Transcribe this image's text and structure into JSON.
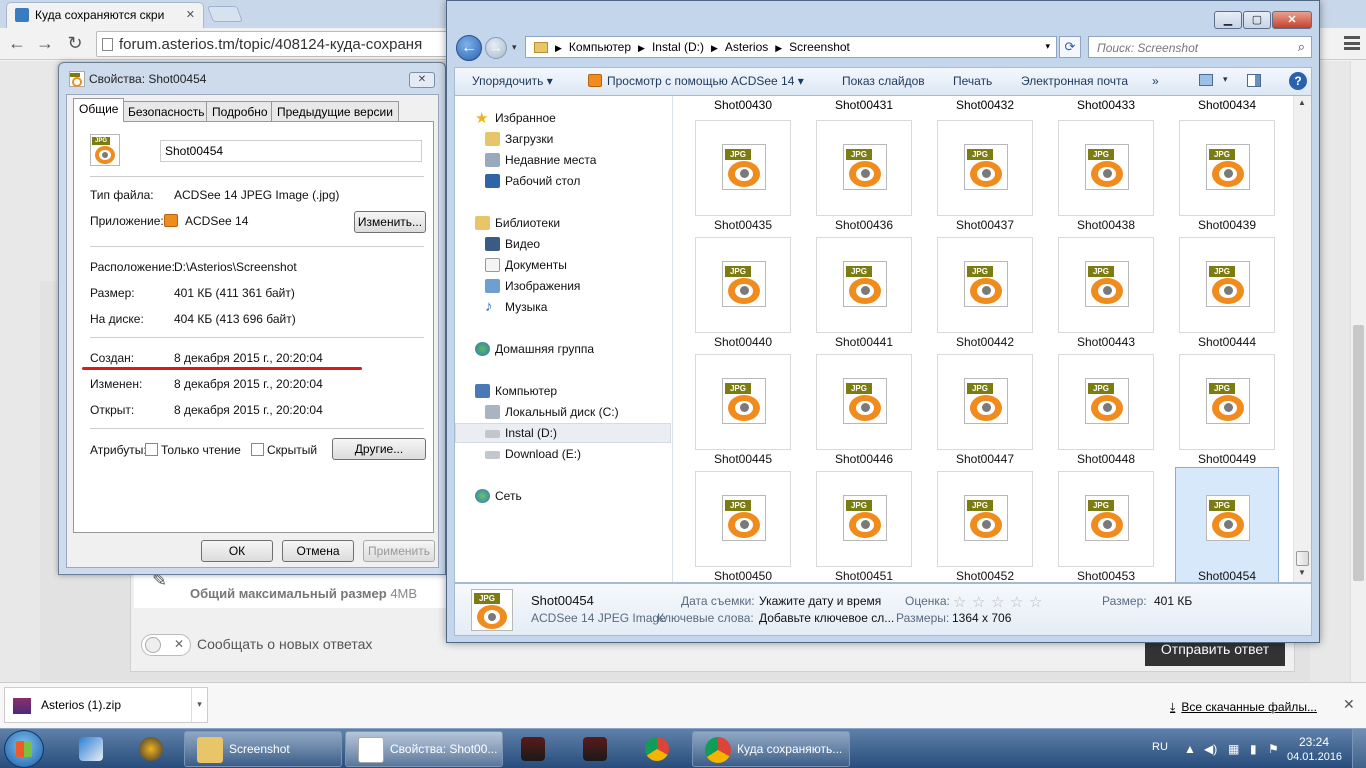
{
  "browser": {
    "tab_title": "Куда сохраняются скри",
    "url": "forum.asterios.tm/topic/408124-куда-сохраня",
    "forum": {
      "max_size_label": "Общий максимальный размер",
      "max_size_value": "4MB",
      "toggle_label": "Сообщать о новых ответах",
      "submit_label": "Отправить ответ"
    },
    "downloads": {
      "file_name": "Asterios (1).zip",
      "all_downloads_label": "Все скачанные файлы..."
    }
  },
  "properties": {
    "title": "Свойства: Shot00454",
    "tabs": [
      "Общие",
      "Безопасность",
      "Подробно",
      "Предыдущие версии"
    ],
    "file_name": "Shot00454",
    "file_type_label": "Тип файла:",
    "file_type": "ACDSee 14 JPEG Image (.jpg)",
    "app_label": "Приложение:",
    "app": "ACDSee 14",
    "change_btn": "Изменить...",
    "location_label": "Расположение:",
    "location": "D:\\Asterios\\Screenshot",
    "size_label": "Размер:",
    "size": "401 КБ (411 361 байт)",
    "disk_label": "На диске:",
    "disk": "404 КБ (413 696 байт)",
    "created_label": "Создан:",
    "created": "8 декабря 2015 г., 20:20:04",
    "modified_label": "Изменен:",
    "modified": "8 декабря 2015 г., 20:20:04",
    "opened_label": "Открыт:",
    "opened": "8 декабря 2015 г., 20:20:04",
    "attrs_label": "Атрибуты:",
    "readonly_label": "Только чтение",
    "hidden_label": "Скрытый",
    "others_btn": "Другие...",
    "ok_btn": "ОК",
    "cancel_btn": "Отмена",
    "apply_btn": "Применить",
    "jpg_tag": "JPG"
  },
  "explorer": {
    "path": [
      "Компьютер",
      "Instal (D:)",
      "Asterios",
      "Screenshot"
    ],
    "search_placeholder": "Поиск: Screenshot",
    "toolbar": {
      "organize": "Упорядочить",
      "view_with": "Просмотр с помощью ACDSee 14",
      "slideshow": "Показ слайдов",
      "print": "Печать",
      "email": "Электронная почта",
      "more": "»"
    },
    "nav": {
      "favorites": "Избранное",
      "downloads": "Загрузки",
      "recent": "Недавние места",
      "desktop": "Рабочий стол",
      "libraries": "Библиотеки",
      "video": "Видео",
      "documents": "Документы",
      "images": "Изображения",
      "music": "Музыка",
      "homegroup": "Домашняя группа",
      "computer": "Компьютер",
      "drive_c": "Локальный диск (C:)",
      "drive_d": "Instal (D:)",
      "drive_e": "Download (E:)",
      "network": "Сеть"
    },
    "top_row": [
      "Shot00430",
      "Shot00431",
      "Shot00432",
      "Shot00433",
      "Shot00434"
    ],
    "files": [
      "Shot00435",
      "Shot00436",
      "Shot00437",
      "Shot00438",
      "Shot00439",
      "Shot00440",
      "Shot00441",
      "Shot00442",
      "Shot00443",
      "Shot00444",
      "Shot00445",
      "Shot00446",
      "Shot00447",
      "Shot00448",
      "Shot00449",
      "Shot00450",
      "Shot00451",
      "Shot00452",
      "Shot00453",
      "Shot00454"
    ],
    "selected_file": "Shot00454",
    "details": {
      "name": "Shot00454",
      "type": "ACDSee 14 JPEG Image",
      "date_label": "Дата съемки:",
      "date_value": "Укажите дату и время",
      "rating_label": "Оценка:",
      "size_label": "Размер:",
      "size_value": "401 КБ",
      "keywords_label": "Ключевые слова:",
      "keywords_value": "Добавьте ключевое сл...",
      "dims_label": "Размеры:",
      "dims_value": "1364 x 706"
    }
  },
  "taskbar": {
    "tasks": [
      "Screenshot",
      "Свойства: Shot00...",
      "Куда сохраняють..."
    ],
    "lang": "RU",
    "time": "23:24",
    "date": "04.01.2016"
  },
  "colors": {
    "highlight_red": "#d81b1b",
    "acdsee_orange": "#f08c1e",
    "jpg_tag": "#7b7d12",
    "selection_blue": "#d8e8fb"
  }
}
